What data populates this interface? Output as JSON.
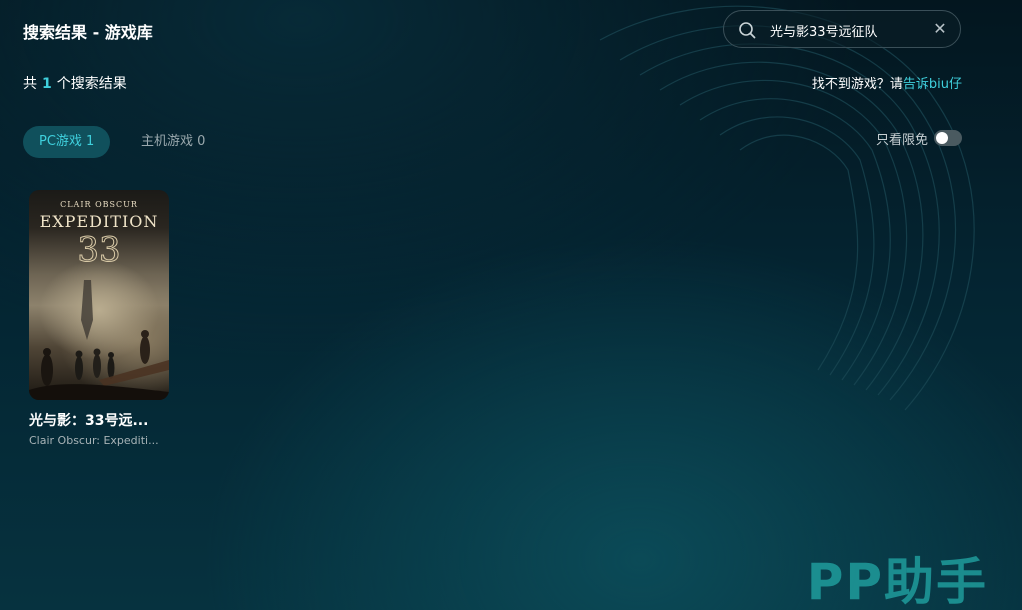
{
  "header": {
    "title": "搜索结果 - 游戏库"
  },
  "search": {
    "value": "光与影33号远征队",
    "placeholder": "",
    "search_icon": "search-icon",
    "clear_icon": "close-icon",
    "clear_label": "✕"
  },
  "results": {
    "prefix": "共",
    "count": "1",
    "suffix": "个搜索结果"
  },
  "feedback": {
    "text": "找不到游戏？请",
    "link": "告诉biu仔"
  },
  "tabs": [
    {
      "label": "PC游戏 1",
      "active": true
    },
    {
      "label": "主机游戏 0",
      "active": false
    }
  ],
  "filter": {
    "label": "只看限免",
    "enabled": false
  },
  "games": [
    {
      "title": "光与影：33号远...",
      "subtitle": "Clair Obscur: Expediti...",
      "cover": {
        "top_text": "CLAIR OBSCUR",
        "title_text": "EXPEDITION",
        "number_text": "33"
      }
    }
  ],
  "brand": {
    "logo": "PP助手"
  },
  "colors": {
    "accent": "#3fd0dd",
    "background": "#042431",
    "tab_active_bg": "#10505c",
    "brand": "#1f9c9c"
  }
}
